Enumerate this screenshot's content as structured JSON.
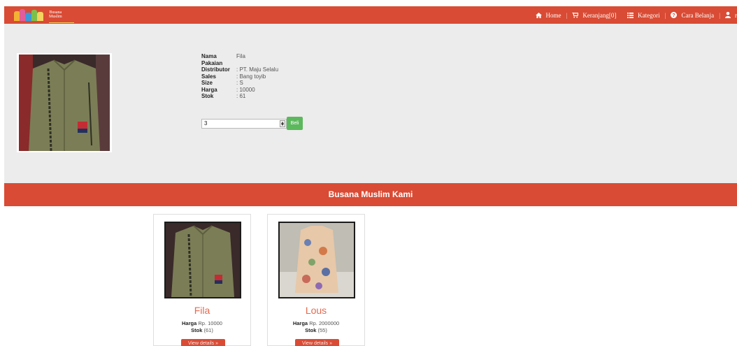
{
  "brand": {
    "logo_line1": "Busana",
    "logo_line2": "Muslim"
  },
  "nav": {
    "home": "Home",
    "cart": "Keranjang[0]",
    "category": "Kategori",
    "howto": "Cara Belanja",
    "user": "r",
    "separator": "|"
  },
  "product": {
    "labels": [
      "Nama Pakaian",
      "Distributor",
      "Sales",
      "Size",
      "Harga",
      "Stok"
    ],
    "values": [
      "Fila",
      ": PT. Maju Selalu",
      ": Bang toyib",
      ": S",
      ": 10000",
      ": 61"
    ],
    "quantity": "3",
    "buy_label": "Beli"
  },
  "section_title": "Busana Muslim Kami",
  "cards": [
    {
      "name": "Fila",
      "price_label": "Harga",
      "price": "Rp. 10000",
      "stock_label": "Stok",
      "stock": "(61)",
      "button": "View details »"
    },
    {
      "name": "Lous",
      "price_label": "Harga",
      "price": "Rp. 2000000",
      "stock_label": "Stok",
      "stock": "(55)",
      "button": "View details »"
    }
  ],
  "colors": {
    "accent": "#d94b34",
    "panel": "#ececec",
    "buy": "#5cb85c",
    "title": "#e7694f"
  },
  "icons": [
    "home-icon",
    "cart-icon",
    "list-icon",
    "question-icon",
    "user-icon"
  ]
}
